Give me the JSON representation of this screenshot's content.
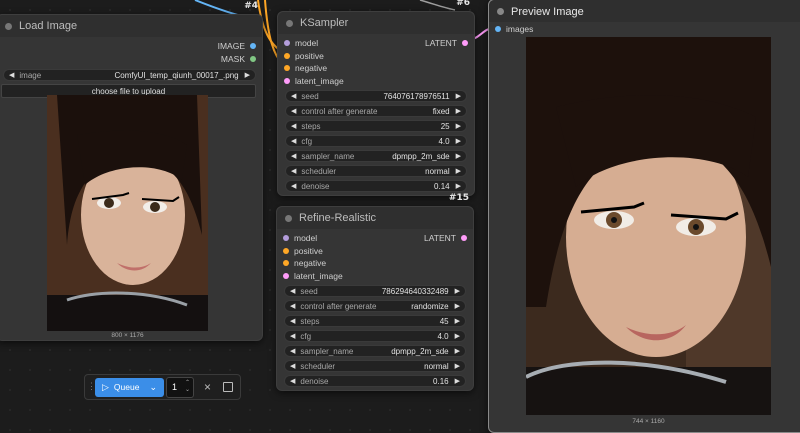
{
  "load_image": {
    "id": "#4",
    "title": "Load Image",
    "outputs": [
      "IMAGE",
      "MASK"
    ],
    "image_widget_label": "image",
    "image_widget_value": "ComfyUI_temp_qiunh_00017_.png",
    "upload_label": "choose file to upload",
    "dims": "800 × 1176"
  },
  "ksampler": {
    "id": "#6",
    "title": "KSampler",
    "inputs": [
      "model",
      "positive",
      "negative",
      "latent_image"
    ],
    "output": "LATENT",
    "widgets": [
      {
        "label": "seed",
        "value": "764076178976511"
      },
      {
        "label": "control after generate",
        "value": "fixed"
      },
      {
        "label": "steps",
        "value": "25"
      },
      {
        "label": "cfg",
        "value": "4.0"
      },
      {
        "label": "sampler_name",
        "value": "dpmpp_2m_sde"
      },
      {
        "label": "scheduler",
        "value": "normal"
      },
      {
        "label": "denoise",
        "value": "0.14"
      }
    ]
  },
  "refine": {
    "id": "#15",
    "title": "Refine-Realistic",
    "inputs": [
      "model",
      "positive",
      "negative",
      "latent_image"
    ],
    "output": "LATENT",
    "widgets": [
      {
        "label": "seed",
        "value": "786294640332489"
      },
      {
        "label": "control after generate",
        "value": "randomize"
      },
      {
        "label": "steps",
        "value": "45"
      },
      {
        "label": "cfg",
        "value": "4.0"
      },
      {
        "label": "sampler_name",
        "value": "dpmpp_2m_sde"
      },
      {
        "label": "scheduler",
        "value": "normal"
      },
      {
        "label": "denoise",
        "value": "0.16"
      }
    ]
  },
  "preview": {
    "title": "Preview Image",
    "input": "images",
    "dims": "744 × 1160"
  },
  "queue": {
    "label": "Queue",
    "count": "1"
  },
  "colors": {
    "model": "#b39ddb",
    "conditioning": "#ffa726",
    "latent": "#ff9cf9",
    "image": "#64b5f6",
    "mask": "#81c784",
    "queue_button": "#3b8ee8"
  }
}
